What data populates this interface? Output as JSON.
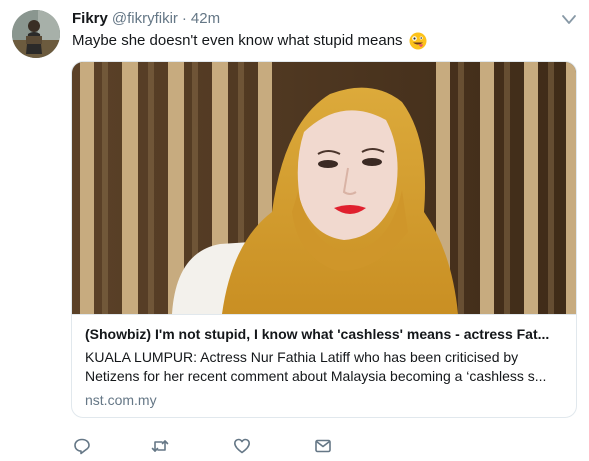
{
  "tweet": {
    "author_name": "Fikry",
    "author_handle": "@fikryfikir",
    "separator": "·",
    "timestamp": "42m",
    "text": "Maybe she doesn't even know what stupid means",
    "emoji": "zany-face-emoji"
  },
  "card": {
    "title": "(Showbiz) I'm not stupid, I know what 'cashless' means - actress Fat...",
    "description_line1": "KUALA LUMPUR: Actress Nur Fathia Latiff who has been criticised by",
    "description_line2": "Netizens for her recent comment about Malaysia becoming a ‘cashless s...",
    "domain": "nst.com.my",
    "image": "woman-in-yellow-hijab-photo"
  },
  "actions": {
    "reply_icon": "reply-icon",
    "retweet_icon": "retweet-icon",
    "like_icon": "heart-icon",
    "dm_icon": "envelope-icon"
  },
  "colors": {
    "secondary_text": "#657786",
    "border": "#e1e8ed",
    "hijab": "#d9a332"
  }
}
